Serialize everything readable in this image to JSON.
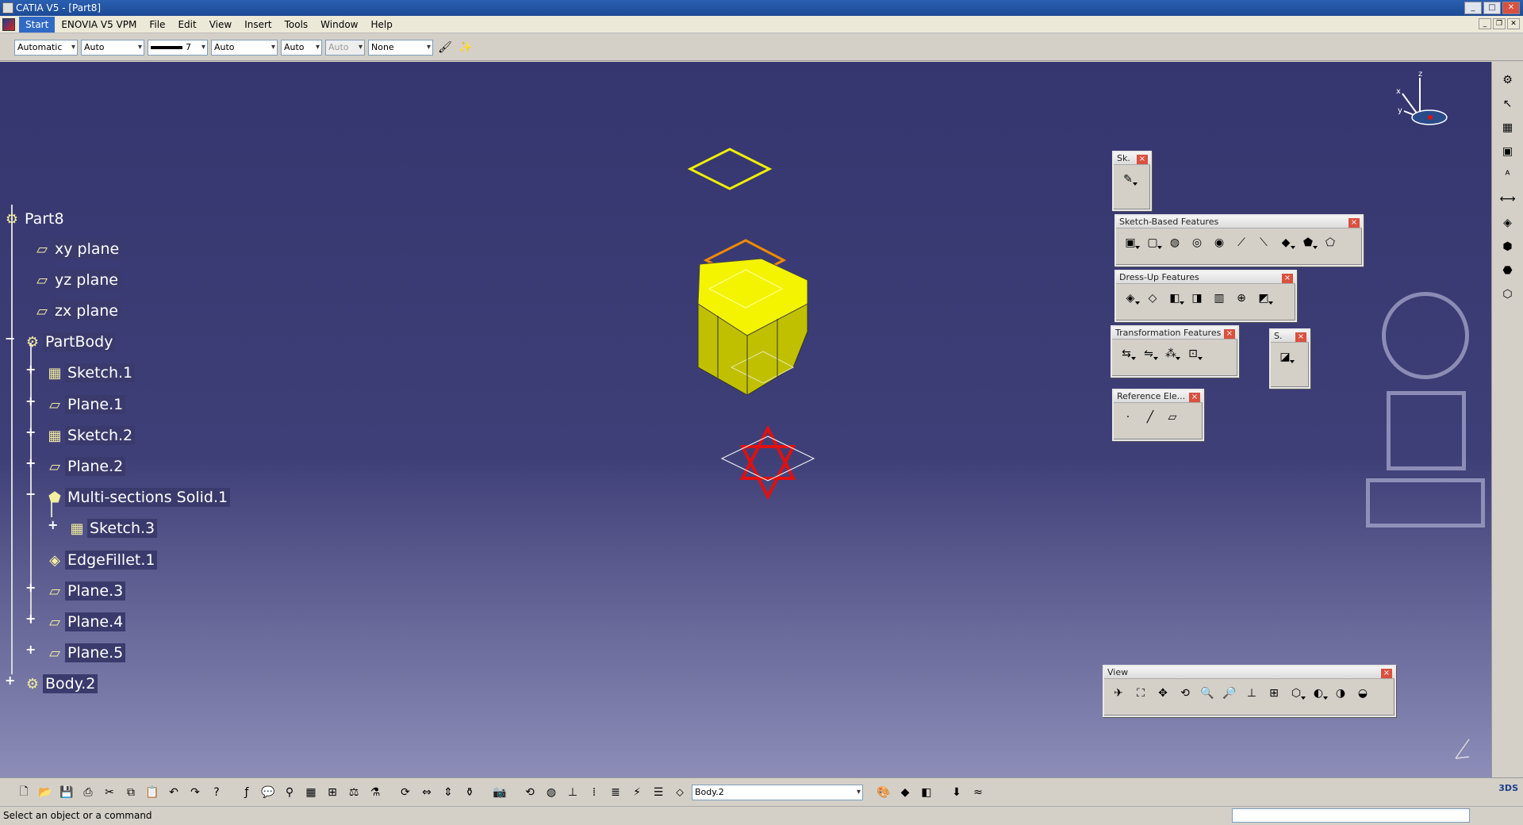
{
  "window": {
    "title": "CATIA V5 - [Part8]"
  },
  "menu": [
    "Start",
    "ENOVIA V5 VPM",
    "File",
    "Edit",
    "View",
    "Insert",
    "Tools",
    "Window",
    "Help"
  ],
  "properties": {
    "color": "Automatic",
    "transparency": "Auto",
    "line_weight": "7",
    "line_type": "Auto",
    "layer": "Auto",
    "rendering": "Auto",
    "layer_name": "None"
  },
  "tree": {
    "root": "Part8",
    "items": [
      {
        "label": "xy plane",
        "icon": "plane-icon"
      },
      {
        "label": "yz plane",
        "icon": "plane-icon"
      },
      {
        "label": "zx plane",
        "icon": "plane-icon"
      },
      {
        "label": "PartBody",
        "icon": "body-icon"
      },
      {
        "label": "Sketch.1",
        "icon": "sketch-icon"
      },
      {
        "label": "Plane.1",
        "icon": "plane-icon"
      },
      {
        "label": "Sketch.2",
        "icon": "sketch-icon"
      },
      {
        "label": "Plane.2",
        "icon": "plane-icon"
      },
      {
        "label": "Multi-sections Solid.1",
        "icon": "loft-icon"
      },
      {
        "label": "Sketch.3",
        "icon": "sketch-icon"
      },
      {
        "label": "EdgeFillet.1",
        "icon": "fillet-icon"
      },
      {
        "label": "Plane.3",
        "icon": "plane-icon"
      },
      {
        "label": "Plane.4",
        "icon": "plane-icon"
      },
      {
        "label": "Plane.5",
        "icon": "plane-icon"
      },
      {
        "label": "Body.2",
        "icon": "body-icon"
      }
    ]
  },
  "toolbars": {
    "sketcher": "Sk.",
    "sketch_based": "Sketch-Based Features",
    "dress_up": "Dress-Up Features",
    "transformation": "Transformation Features",
    "surface": "S.",
    "reference": "Reference Ele...",
    "view": "View"
  },
  "bottom": {
    "current_body": "Body.2"
  },
  "status": {
    "message": "Select an object or a command"
  },
  "compass": {
    "x": "x",
    "y": "y",
    "z": "z"
  },
  "colors": {
    "yellow": "#f0f000",
    "orange": "#f08a00",
    "red": "#e01010",
    "background_top": "#35356f"
  }
}
